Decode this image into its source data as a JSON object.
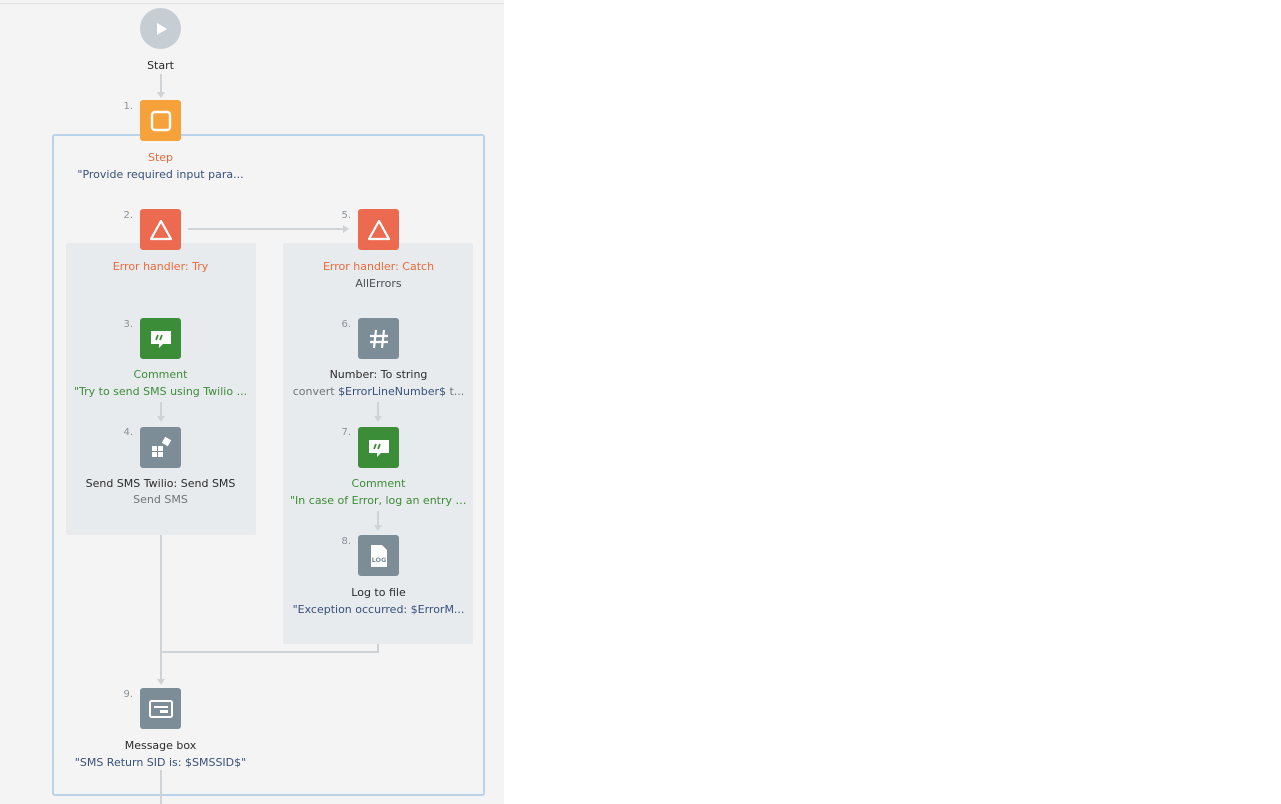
{
  "flow": {
    "start": {
      "label": "Start",
      "icon": "play-icon"
    },
    "steps": [
      {
        "num": "1.",
        "title": "Step",
        "subtitle": "\"Provide required input para...",
        "icon": "step-square-icon",
        "color": "#f7a13a"
      },
      {
        "num": "2.",
        "title": "Error handler: Try",
        "subtitle": "",
        "icon": "warning-triangle-icon",
        "color": "#eb6a50"
      },
      {
        "num": "3.",
        "title": "Comment",
        "subtitle": "\"Try to send SMS using Twilio ...",
        "icon": "comment-icon",
        "color": "#3b8d37"
      },
      {
        "num": "4.",
        "title": "Send SMS Twilio: Send SMS",
        "subtitle": "Send SMS",
        "icon": "plugin-blocks-icon",
        "color": "#7c8d98"
      },
      {
        "num": "5.",
        "title": "Error handler: Catch",
        "subtitle": "AllErrors",
        "icon": "warning-triangle-icon",
        "color": "#eb6a50"
      },
      {
        "num": "6.",
        "title": "Number: To string",
        "subtitle_prefix": "convert ",
        "subtitle_var": "$ErrorLineNumber$",
        "subtitle_suffix": " t...",
        "icon": "hash-icon",
        "color": "#7c8d98"
      },
      {
        "num": "7.",
        "title": "Comment",
        "subtitle": "\"In case of Error, log an entry i...",
        "icon": "comment-icon",
        "color": "#3b8d37"
      },
      {
        "num": "8.",
        "title": "Log to file",
        "subtitle": "\"Exception occurred: $ErrorM...",
        "icon": "log-file-icon",
        "color": "#7c8d98",
        "icon_text": "LOG"
      },
      {
        "num": "9.",
        "title": "Message box",
        "subtitle": "\"SMS Return SID is: $SMSSID$\"",
        "icon": "message-box-icon",
        "color": "#7c8d98"
      }
    ]
  }
}
